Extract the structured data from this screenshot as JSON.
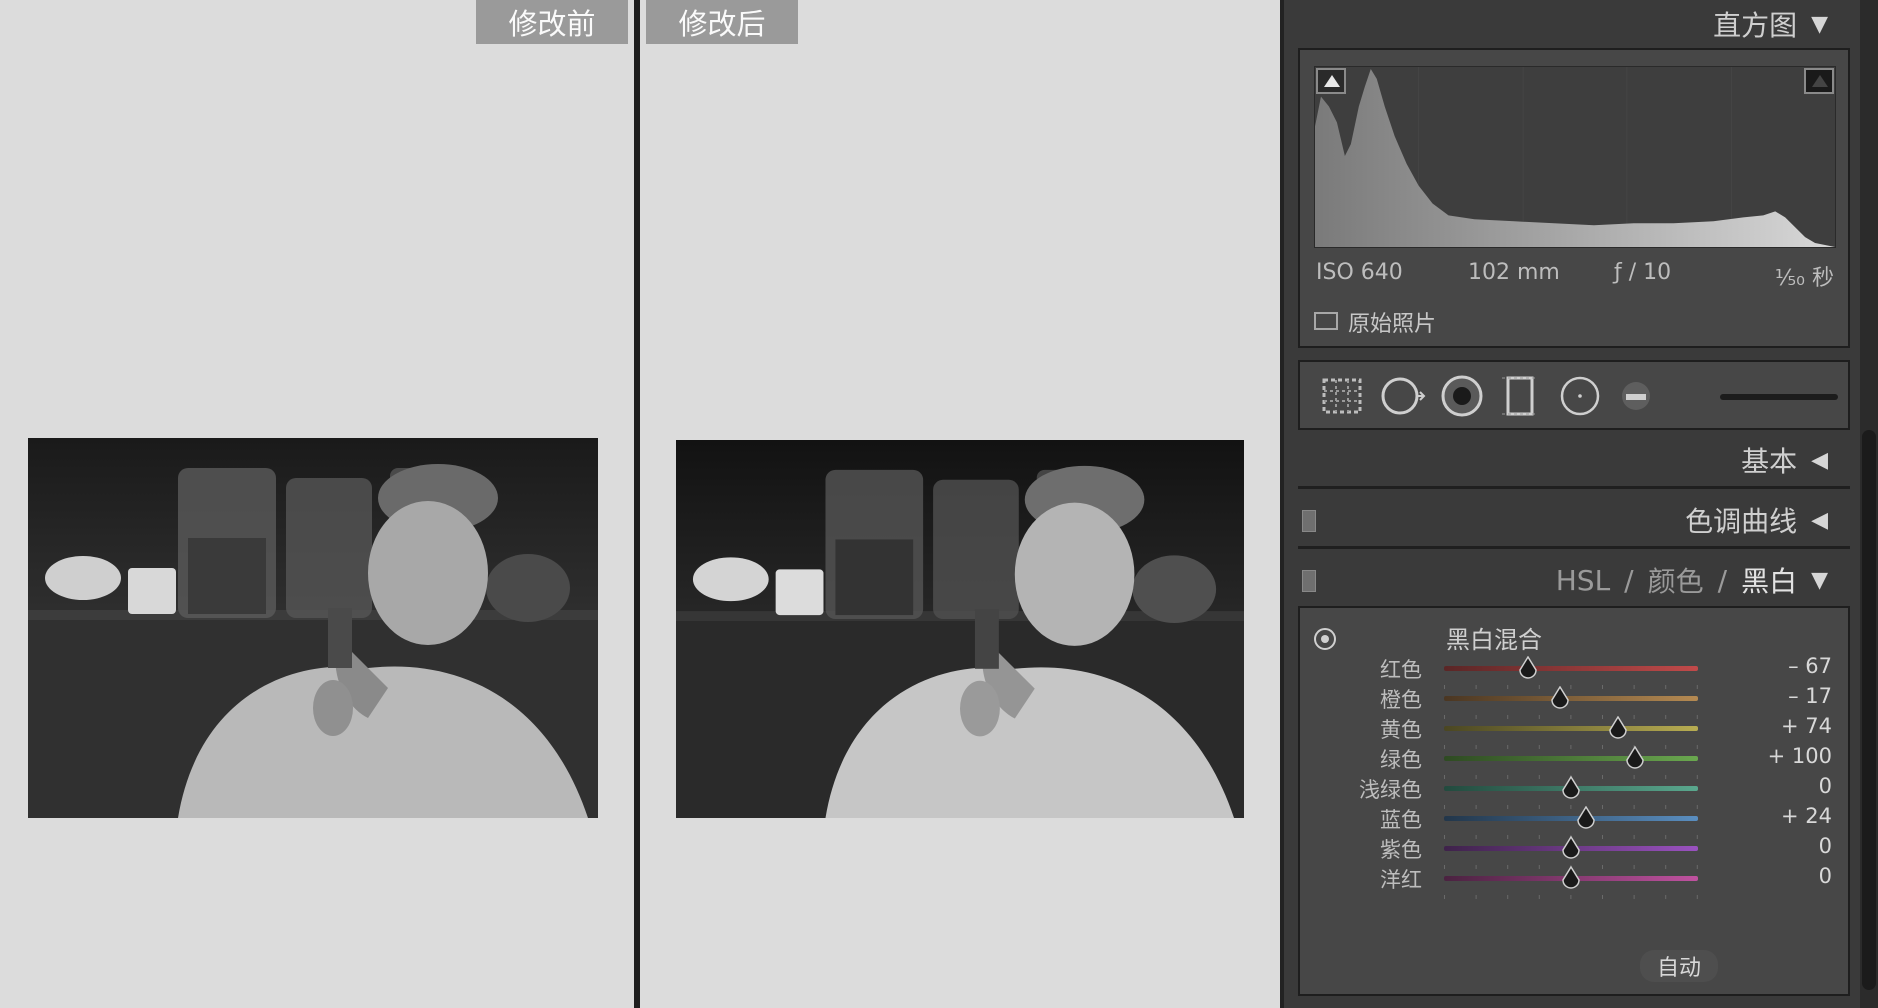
{
  "compare": {
    "before_label": "修改前",
    "after_label": "修改后"
  },
  "panel": {
    "histogram": {
      "title": "直方图",
      "iso": "ISO 640",
      "focal": "102 mm",
      "aperture": "ƒ / 10",
      "shutter": "¹⁄₅₀ 秒",
      "original_photo_label": "原始照片"
    },
    "sections": {
      "basic": "基本",
      "tone_curve": "色调曲线",
      "hsl": "HSL",
      "slash": "/",
      "color": "颜色",
      "bw": "黑白"
    },
    "bw_mix": {
      "title": "黑白混合",
      "auto_label": "自动",
      "channels": [
        {
          "label": "红色",
          "value_text": "– 67",
          "value": -67,
          "color_from": "#5a2626",
          "color_to": "#c24a4a"
        },
        {
          "label": "橙色",
          "value_text": "– 17",
          "value": -17,
          "color_from": "#4a3622",
          "color_to": "#b58a52"
        },
        {
          "label": "黄色",
          "value_text": "+ 74",
          "value": 74,
          "color_from": "#4a4622",
          "color_to": "#b8ad52"
        },
        {
          "label": "绿色",
          "value_text": "+ 100",
          "value": 100,
          "color_from": "#2e4a22",
          "color_to": "#6aa84f"
        },
        {
          "label": "浅绿色",
          "value_text": "0",
          "value": 0,
          "color_from": "#224a3e",
          "color_to": "#5aa88e"
        },
        {
          "label": "蓝色",
          "value_text": "+ 24",
          "value": 24,
          "color_from": "#22364a",
          "color_to": "#5a8ec0"
        },
        {
          "label": "紫色",
          "value_text": "0",
          "value": 0,
          "color_from": "#3e224a",
          "color_to": "#9a52c0"
        },
        {
          "label": "洋红",
          "value_text": "0",
          "value": 0,
          "color_from": "#4a2240",
          "color_to": "#c052a0"
        }
      ]
    }
  }
}
